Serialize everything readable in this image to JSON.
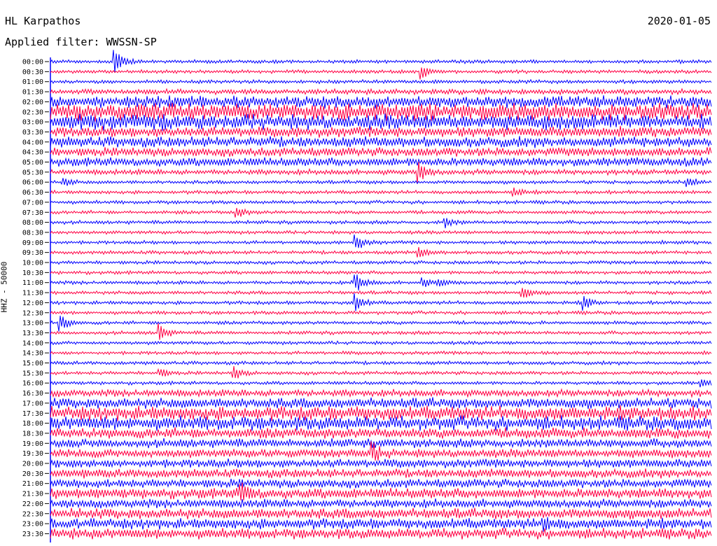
{
  "header": {
    "station": "HL Karpathos",
    "date": "2020-01-05",
    "filter": "Applied filter: WWSSN-SP",
    "channel": "HHZ - 50000"
  },
  "chart_data": {
    "type": "line",
    "subtype": "helicorder",
    "x": {
      "label": "",
      "unit": "minutes",
      "range": [
        0,
        30
      ]
    },
    "rows": [
      {
        "label": "00:00",
        "color": "blue",
        "amp": 2,
        "events": [
          {
            "t": 2.9,
            "a": 18
          }
        ]
      },
      {
        "label": "00:30",
        "color": "red",
        "amp": 2,
        "events": [
          {
            "t": 16.8,
            "a": 12
          }
        ]
      },
      {
        "label": "01:00",
        "color": "blue",
        "amp": 2,
        "events": []
      },
      {
        "label": "01:30",
        "color": "red",
        "amp": 3,
        "events": []
      },
      {
        "label": "02:00",
        "color": "blue",
        "amp": 7,
        "events": []
      },
      {
        "label": "02:30",
        "color": "red",
        "amp": 10,
        "events": []
      },
      {
        "label": "03:00",
        "color": "blue",
        "amp": 9,
        "events": []
      },
      {
        "label": "03:30",
        "color": "red",
        "amp": 6,
        "events": []
      },
      {
        "label": "04:00",
        "color": "blue",
        "amp": 6,
        "events": []
      },
      {
        "label": "04:30",
        "color": "red",
        "amp": 5,
        "events": []
      },
      {
        "label": "05:00",
        "color": "blue",
        "amp": 5,
        "events": []
      },
      {
        "label": "05:30",
        "color": "red",
        "amp": 3,
        "events": [
          {
            "t": 16.7,
            "a": 14
          }
        ]
      },
      {
        "label": "06:00",
        "color": "blue",
        "amp": 2,
        "events": [
          {
            "t": 0.6,
            "a": 6
          },
          {
            "t": 28.9,
            "a": 7
          }
        ]
      },
      {
        "label": "06:30",
        "color": "red",
        "amp": 2,
        "events": [
          {
            "t": 21.0,
            "a": 7
          }
        ]
      },
      {
        "label": "07:00",
        "color": "blue",
        "amp": 2,
        "events": []
      },
      {
        "label": "07:30",
        "color": "red",
        "amp": 2,
        "events": [
          {
            "t": 8.4,
            "a": 9
          }
        ]
      },
      {
        "label": "08:00",
        "color": "blue",
        "amp": 2,
        "events": [
          {
            "t": 17.9,
            "a": 7
          }
        ]
      },
      {
        "label": "08:30",
        "color": "red",
        "amp": 2,
        "events": []
      },
      {
        "label": "09:00",
        "color": "blue",
        "amp": 2,
        "events": [
          {
            "t": 13.8,
            "a": 14
          }
        ]
      },
      {
        "label": "09:30",
        "color": "red",
        "amp": 2,
        "events": [
          {
            "t": 16.7,
            "a": 8
          }
        ]
      },
      {
        "label": "10:00",
        "color": "blue",
        "amp": 2,
        "events": []
      },
      {
        "label": "10:30",
        "color": "red",
        "amp": 2,
        "events": []
      },
      {
        "label": "11:00",
        "color": "blue",
        "amp": 2,
        "events": [
          {
            "t": 13.8,
            "a": 18
          },
          {
            "t": 16.9,
            "a": 6
          },
          {
            "t": 17.6,
            "a": 6
          }
        ]
      },
      {
        "label": "11:30",
        "color": "red",
        "amp": 2,
        "events": [
          {
            "t": 21.4,
            "a": 10
          }
        ]
      },
      {
        "label": "12:00",
        "color": "blue",
        "amp": 2,
        "events": [
          {
            "t": 13.8,
            "a": 14
          },
          {
            "t": 24.2,
            "a": 10
          }
        ]
      },
      {
        "label": "12:30",
        "color": "red",
        "amp": 2,
        "events": []
      },
      {
        "label": "13:00",
        "color": "blue",
        "amp": 2,
        "events": [
          {
            "t": 0.4,
            "a": 14
          }
        ]
      },
      {
        "label": "13:30",
        "color": "red",
        "amp": 2,
        "events": [
          {
            "t": 4.9,
            "a": 14
          }
        ]
      },
      {
        "label": "14:00",
        "color": "blue",
        "amp": 2,
        "events": []
      },
      {
        "label": "14:30",
        "color": "red",
        "amp": 2,
        "events": []
      },
      {
        "label": "15:00",
        "color": "blue",
        "amp": 2,
        "events": []
      },
      {
        "label": "15:30",
        "color": "red",
        "amp": 2,
        "events": [
          {
            "t": 8.3,
            "a": 10
          },
          {
            "t": 4.9,
            "a": 7
          }
        ]
      },
      {
        "label": "16:00",
        "color": "blue",
        "amp": 2,
        "events": [
          {
            "t": 29.5,
            "a": 7
          }
        ]
      },
      {
        "label": "16:30",
        "color": "red",
        "amp": 4,
        "events": []
      },
      {
        "label": "17:00",
        "color": "blue",
        "amp": 6,
        "events": []
      },
      {
        "label": "17:30",
        "color": "red",
        "amp": 8,
        "events": []
      },
      {
        "label": "18:00",
        "color": "blue",
        "amp": 8,
        "events": []
      },
      {
        "label": "18:30",
        "color": "red",
        "amp": 6,
        "events": []
      },
      {
        "label": "19:00",
        "color": "blue",
        "amp": 5,
        "events": []
      },
      {
        "label": "19:30",
        "color": "red",
        "amp": 5,
        "events": [
          {
            "t": 14.6,
            "a": 12
          }
        ]
      },
      {
        "label": "20:00",
        "color": "blue",
        "amp": 5,
        "events": []
      },
      {
        "label": "20:30",
        "color": "red",
        "amp": 5,
        "events": []
      },
      {
        "label": "21:00",
        "color": "blue",
        "amp": 5,
        "events": []
      },
      {
        "label": "21:30",
        "color": "red",
        "amp": 6,
        "events": [
          {
            "t": 8.6,
            "a": 18
          }
        ]
      },
      {
        "label": "22:00",
        "color": "blue",
        "amp": 5,
        "events": []
      },
      {
        "label": "22:30",
        "color": "red",
        "amp": 6,
        "events": []
      },
      {
        "label": "23:00",
        "color": "blue",
        "amp": 6,
        "events": [
          {
            "t": 22.4,
            "a": 9
          }
        ]
      },
      {
        "label": "23:30",
        "color": "red",
        "amp": 6,
        "events": []
      }
    ],
    "colors": {
      "blue": "#0000ff",
      "red": "#ff0044",
      "text": "#000000"
    },
    "grid": false,
    "legend": "none"
  }
}
